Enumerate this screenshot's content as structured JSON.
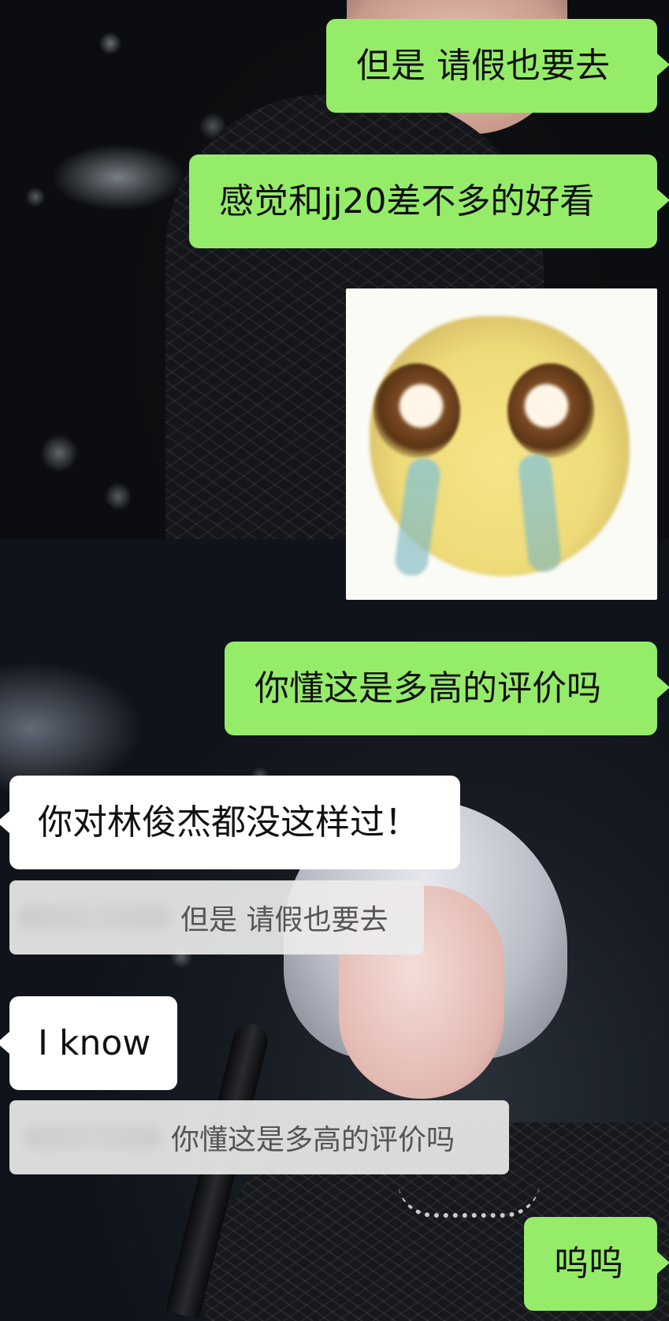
{
  "messages": [
    {
      "id": "m1",
      "direction": "sent",
      "type": "text",
      "text": "但是 请假也要去"
    },
    {
      "id": "m2",
      "direction": "sent",
      "type": "text",
      "text": "感觉和jj20差不多的好看"
    },
    {
      "id": "m3",
      "direction": "sent",
      "type": "sticker",
      "sticker": "crying-yellow-face-sticker"
    },
    {
      "id": "m4",
      "direction": "sent",
      "type": "text",
      "text": "你懂这是多高的评价吗"
    },
    {
      "id": "m5",
      "direction": "received",
      "type": "text",
      "text": "你对林俊杰都没这样过！",
      "quote": "但是 请假也要去"
    },
    {
      "id": "m6",
      "direction": "received",
      "type": "text",
      "text": "I know",
      "quote": "你懂这是多高的评价吗"
    },
    {
      "id": "m7",
      "direction": "sent",
      "type": "text",
      "text": "呜呜"
    }
  ],
  "colors": {
    "sent_bubble": "#95ec69",
    "received_bubble": "#ffffff",
    "quote_bg": "#ececec"
  }
}
